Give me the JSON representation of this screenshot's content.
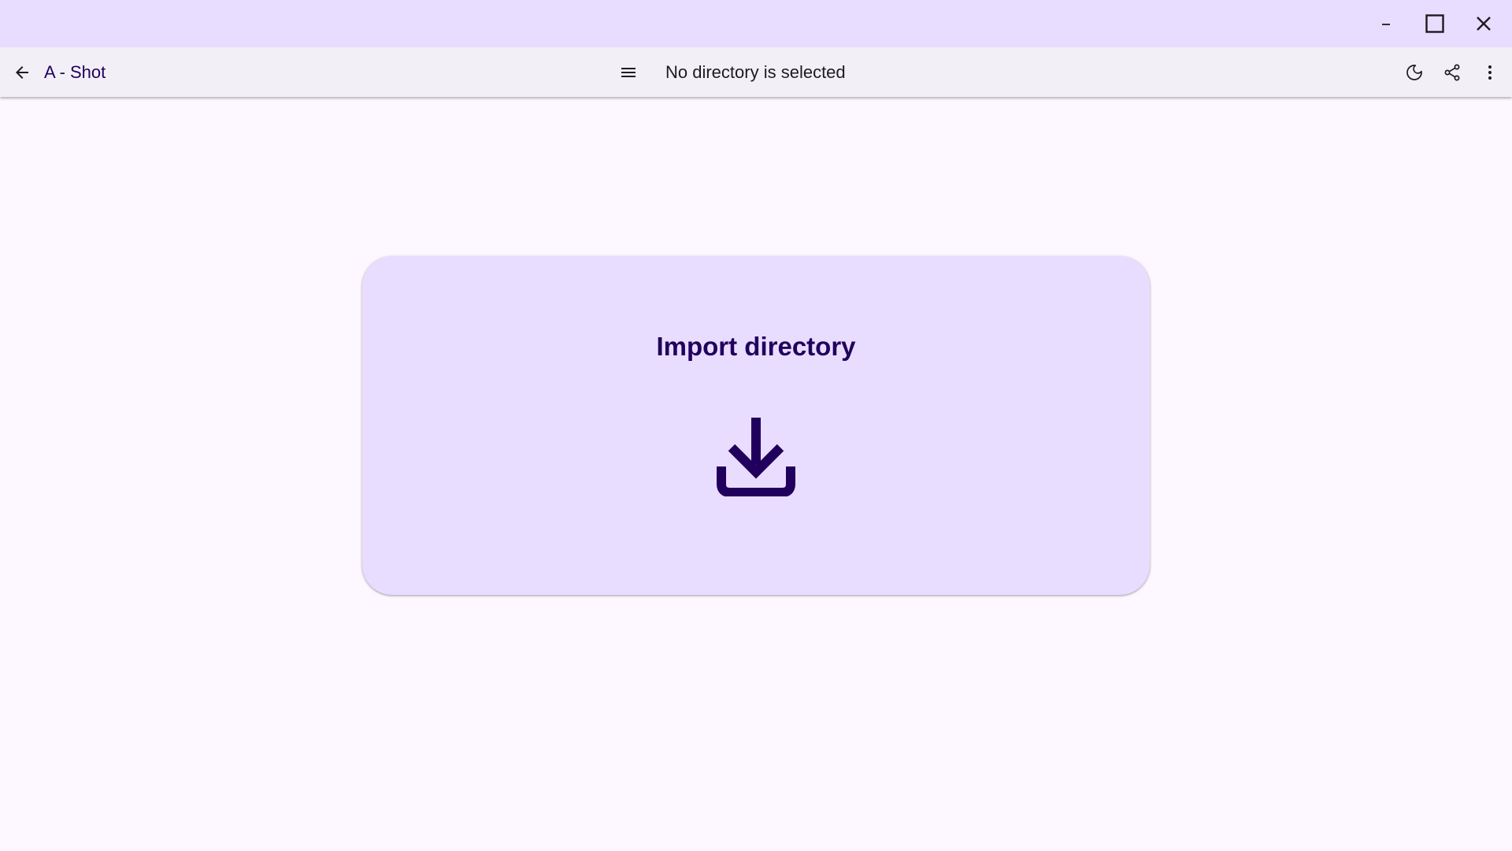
{
  "window_controls": {
    "minimize_icon": "minimize-icon",
    "maximize_icon": "maximize-icon",
    "close_icon": "close-icon"
  },
  "appbar": {
    "back_icon": "arrow-back-icon",
    "app_title": "A - Shot",
    "menu_icon": "hamburger-menu-icon",
    "directory_title": "No directory is selected",
    "actions": {
      "theme_icon": "dark-mode-moon-icon",
      "share_icon": "share-icon",
      "more_icon": "more-vert-icon"
    }
  },
  "import_card": {
    "title": "Import directory",
    "icon": "download-icon"
  },
  "colors": {
    "titlebar_bg": "#e9ddff",
    "appbar_bg": "#f3eff7",
    "page_bg": "#fdf7ff",
    "card_bg": "#e9ddff",
    "accent": "#21005d"
  }
}
